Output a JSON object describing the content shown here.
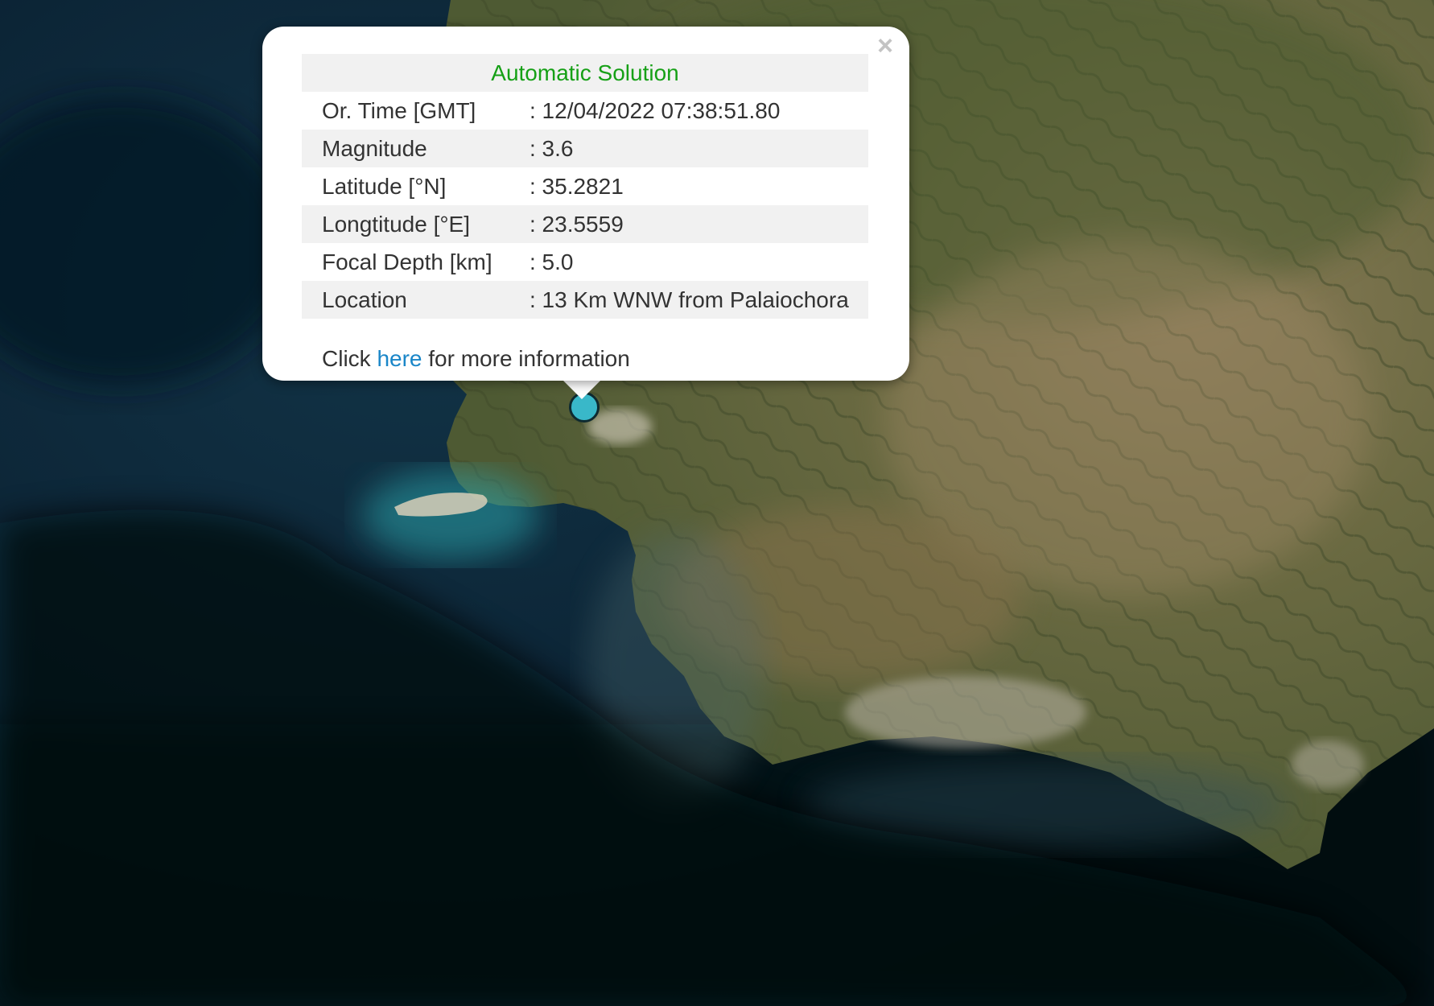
{
  "map": {
    "basemap": "satellite",
    "colors": {
      "deep_sea": "#06131d",
      "sea": "#0f2f45",
      "shallow_sea": "#2aa3aa",
      "land_green": "#5f6b3a",
      "land_brown": "#8a7a58",
      "urban": "#b9b3a5"
    }
  },
  "marker": {
    "icon": "circle-marker-icon",
    "color": "#39b8c9"
  },
  "popup": {
    "close_symbol": "×",
    "title": "Automatic Solution",
    "rows": [
      {
        "label": "Or. Time [GMT]",
        "value": ": 12/04/2022 07:38:51.80"
      },
      {
        "label": "Magnitude",
        "value": ": 3.6"
      },
      {
        "label": "Latitude [°N]",
        "value": ": 35.2821"
      },
      {
        "label": "Longtitude [°E]",
        "value": ": 23.5559"
      },
      {
        "label": "Focal Depth [km]",
        "value": ": 5.0"
      },
      {
        "label": "Location",
        "value": ": 13 Km WNW from Palaiochora"
      }
    ],
    "footer": {
      "prefix": "Click",
      "link": "here",
      "suffix": "for more information"
    },
    "title_color": "#16a016",
    "link_color": "#1a86c8"
  }
}
